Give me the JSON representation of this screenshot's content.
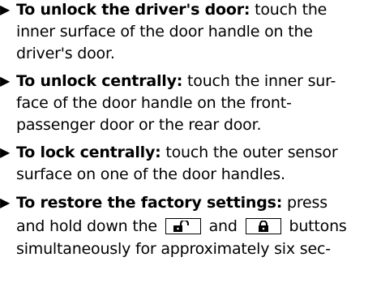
{
  "items": [
    {
      "lead": "To unlock the driver's door:",
      "line1_rest": " touch the",
      "line2": "inner surface of the door handle on the",
      "line3": "driver's door."
    },
    {
      "lead": "To unlock centrally:",
      "line1_rest": " touch the inner sur-",
      "line2": "face of the door handle on the front-",
      "line3": "passenger door or the rear door."
    },
    {
      "lead": "To lock centrally:",
      "line1_rest": " touch the outer sensor",
      "line2": "surface on one of the door handles."
    },
    {
      "lead": "To restore the factory settings:",
      "line1_rest": " press",
      "line2_a": "and hold down the",
      "line2_b": "and",
      "line2_c": "buttons",
      "line3": "simultaneously for approximately six sec-"
    }
  ],
  "bullet_glyph": "▶",
  "icons": [
    "unlock-icon",
    "lock-icon"
  ]
}
